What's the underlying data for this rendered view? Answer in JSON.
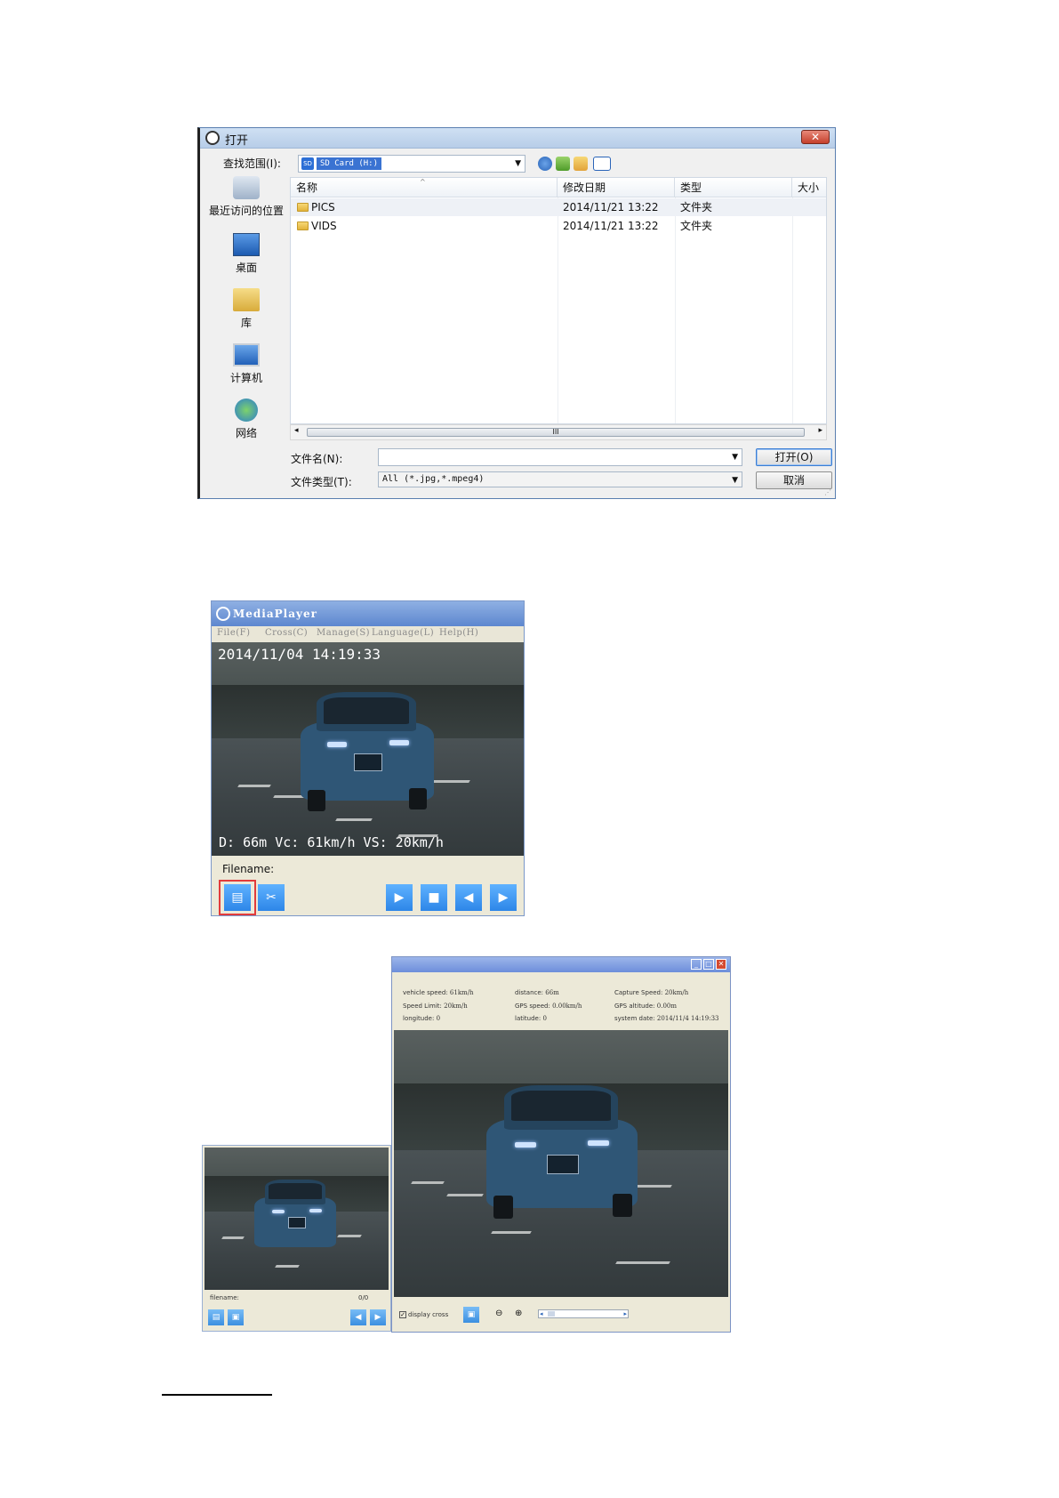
{
  "open_dialog": {
    "title": "打开",
    "close_label": "✕",
    "look_in_label": "查找范围(I):",
    "look_in_value": "SD Card (H:)",
    "places": [
      {
        "label": "最近访问的位置",
        "icon": "recent-places-icon"
      },
      {
        "label": "桌面",
        "icon": "desktop-icon"
      },
      {
        "label": "库",
        "icon": "libraries-icon"
      },
      {
        "label": "计算机",
        "icon": "computer-icon"
      },
      {
        "label": "网络",
        "icon": "network-icon"
      }
    ],
    "columns": [
      "名称",
      "修改日期",
      "类型",
      "大小"
    ],
    "rows": [
      {
        "name": "PICS",
        "date": "2014/11/21 13:22",
        "type": "文件夹"
      },
      {
        "name": "VIDS",
        "date": "2014/11/21 13:22",
        "type": "文件夹"
      }
    ],
    "scroll_thumb_label": "III",
    "filename_label": "文件名(N):",
    "filename_value": "",
    "filetype_label": "文件类型(T):",
    "filetype_value": "All (*.jpg,*.mpeg4)",
    "open_button": "打开(O)",
    "cancel_button": "取消"
  },
  "media_player": {
    "title": "MediaPlayer",
    "menu": [
      "File(F)",
      "Cross(C)",
      "Manage(S)",
      "Language(L)",
      "Help(H)"
    ],
    "timestamp": "2014/11/04 14:19:33",
    "overlay": "D: 66m Vc: 61km/h VS: 20km/h",
    "filename_label": "Filename:"
  },
  "player_small": {
    "filename_label": "filename:",
    "counter": "0/0"
  },
  "player_detail": {
    "info": {
      "vehicle_speed_label": "vehicle speed:",
      "vehicle_speed_value": "61km/h",
      "distance_label": "distance:",
      "distance_value": "66m",
      "capture_speed_label": "Capture Speed:",
      "capture_speed_value": "20km/h",
      "speed_limit_label": "Speed Limit:",
      "speed_limit_value": "20km/h",
      "gps_speed_label": "GPS speed:",
      "gps_speed_value": "0.00km/h",
      "gps_altitude_label": "GPS altitude:",
      "gps_altitude_value": "0.00m",
      "longitude_label": "longitude:",
      "longitude_value": "0",
      "latitude_label": "latitude:",
      "latitude_value": "0",
      "system_date_label": "system date:",
      "system_date_value": "2014/11/4 14:19:33"
    },
    "display_cross_label": "display cross",
    "display_cross_checked": true
  }
}
